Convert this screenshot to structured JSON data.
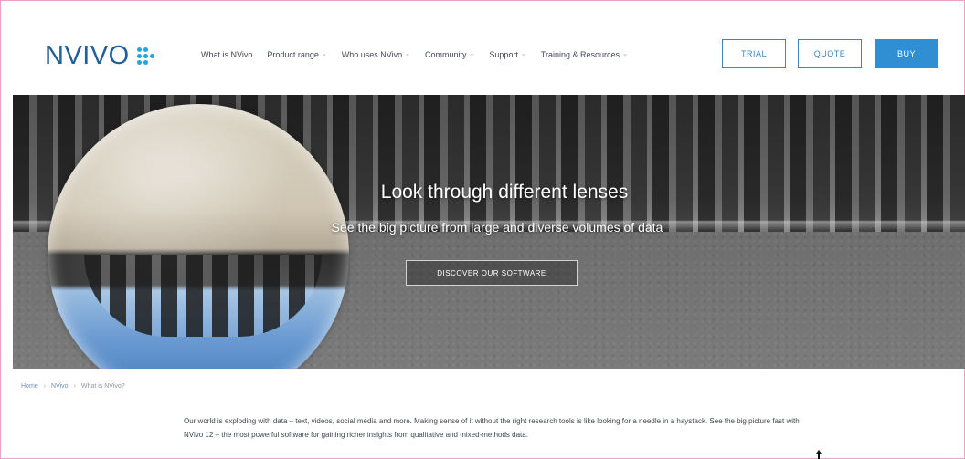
{
  "header": {
    "logo_text": "NVIVO",
    "nav": [
      {
        "label": "What is NVivo",
        "has_dropdown": false
      },
      {
        "label": "Product range",
        "has_dropdown": true
      },
      {
        "label": "Who uses NVivo",
        "has_dropdown": true
      },
      {
        "label": "Community",
        "has_dropdown": true
      },
      {
        "label": "Support",
        "has_dropdown": true
      },
      {
        "label": "Training & Resources",
        "has_dropdown": true
      }
    ],
    "buttons": {
      "trial": "TRIAL",
      "quote": "QUOTE",
      "buy": "BUY"
    }
  },
  "hero": {
    "title": "Look through different lenses",
    "subtitle": "See the big picture from large and diverse volumes of data",
    "cta": "DISCOVER OUR SOFTWARE"
  },
  "breadcrumb": {
    "items": [
      "Home",
      "NVivo",
      "What is NVivo?"
    ]
  },
  "intro": {
    "text": "Our world is exploding with data – text, videos, social media and more. Making sense of it without the right research tools is like looking for a needle in a haystack. See the big picture fast with NVivo 12 – the most powerful software for gaining richer insights from qualitative and mixed-methods data."
  },
  "icons": {
    "logo_mark": "logo-dots-icon",
    "dropdown": "chevron-down-icon",
    "breadcrumb_separator": "chevron-right-icon"
  },
  "colors": {
    "brand_blue": "#1f5f9a",
    "accent_blue": "#2f8fd2",
    "frame_border": "#e9a2c9"
  }
}
